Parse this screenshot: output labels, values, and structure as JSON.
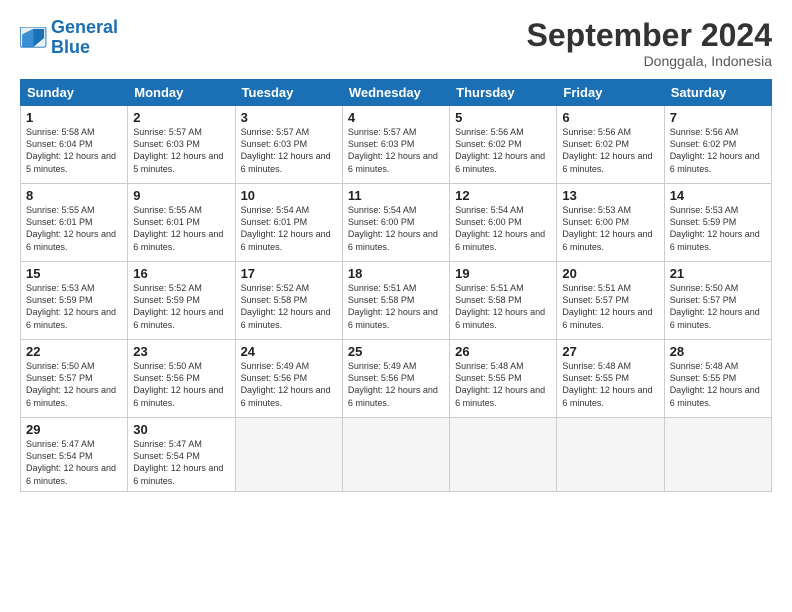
{
  "header": {
    "logo_line1": "General",
    "logo_line2": "Blue",
    "month": "September 2024",
    "location": "Donggala, Indonesia"
  },
  "days_of_week": [
    "Sunday",
    "Monday",
    "Tuesday",
    "Wednesday",
    "Thursday",
    "Friday",
    "Saturday"
  ],
  "weeks": [
    [
      {
        "day": "1",
        "sunrise": "5:58 AM",
        "sunset": "6:04 PM",
        "daylight": "12 hours and 5 minutes."
      },
      {
        "day": "2",
        "sunrise": "5:57 AM",
        "sunset": "6:03 PM",
        "daylight": "12 hours and 5 minutes."
      },
      {
        "day": "3",
        "sunrise": "5:57 AM",
        "sunset": "6:03 PM",
        "daylight": "12 hours and 6 minutes."
      },
      {
        "day": "4",
        "sunrise": "5:57 AM",
        "sunset": "6:03 PM",
        "daylight": "12 hours and 6 minutes."
      },
      {
        "day": "5",
        "sunrise": "5:56 AM",
        "sunset": "6:02 PM",
        "daylight": "12 hours and 6 minutes."
      },
      {
        "day": "6",
        "sunrise": "5:56 AM",
        "sunset": "6:02 PM",
        "daylight": "12 hours and 6 minutes."
      },
      {
        "day": "7",
        "sunrise": "5:56 AM",
        "sunset": "6:02 PM",
        "daylight": "12 hours and 6 minutes."
      }
    ],
    [
      {
        "day": "8",
        "sunrise": "5:55 AM",
        "sunset": "6:01 PM",
        "daylight": "12 hours and 6 minutes."
      },
      {
        "day": "9",
        "sunrise": "5:55 AM",
        "sunset": "6:01 PM",
        "daylight": "12 hours and 6 minutes."
      },
      {
        "day": "10",
        "sunrise": "5:54 AM",
        "sunset": "6:01 PM",
        "daylight": "12 hours and 6 minutes."
      },
      {
        "day": "11",
        "sunrise": "5:54 AM",
        "sunset": "6:00 PM",
        "daylight": "12 hours and 6 minutes."
      },
      {
        "day": "12",
        "sunrise": "5:54 AM",
        "sunset": "6:00 PM",
        "daylight": "12 hours and 6 minutes."
      },
      {
        "day": "13",
        "sunrise": "5:53 AM",
        "sunset": "6:00 PM",
        "daylight": "12 hours and 6 minutes."
      },
      {
        "day": "14",
        "sunrise": "5:53 AM",
        "sunset": "5:59 PM",
        "daylight": "12 hours and 6 minutes."
      }
    ],
    [
      {
        "day": "15",
        "sunrise": "5:53 AM",
        "sunset": "5:59 PM",
        "daylight": "12 hours and 6 minutes."
      },
      {
        "day": "16",
        "sunrise": "5:52 AM",
        "sunset": "5:59 PM",
        "daylight": "12 hours and 6 minutes."
      },
      {
        "day": "17",
        "sunrise": "5:52 AM",
        "sunset": "5:58 PM",
        "daylight": "12 hours and 6 minutes."
      },
      {
        "day": "18",
        "sunrise": "5:51 AM",
        "sunset": "5:58 PM",
        "daylight": "12 hours and 6 minutes."
      },
      {
        "day": "19",
        "sunrise": "5:51 AM",
        "sunset": "5:58 PM",
        "daylight": "12 hours and 6 minutes."
      },
      {
        "day": "20",
        "sunrise": "5:51 AM",
        "sunset": "5:57 PM",
        "daylight": "12 hours and 6 minutes."
      },
      {
        "day": "21",
        "sunrise": "5:50 AM",
        "sunset": "5:57 PM",
        "daylight": "12 hours and 6 minutes."
      }
    ],
    [
      {
        "day": "22",
        "sunrise": "5:50 AM",
        "sunset": "5:57 PM",
        "daylight": "12 hours and 6 minutes."
      },
      {
        "day": "23",
        "sunrise": "5:50 AM",
        "sunset": "5:56 PM",
        "daylight": "12 hours and 6 minutes."
      },
      {
        "day": "24",
        "sunrise": "5:49 AM",
        "sunset": "5:56 PM",
        "daylight": "12 hours and 6 minutes."
      },
      {
        "day": "25",
        "sunrise": "5:49 AM",
        "sunset": "5:56 PM",
        "daylight": "12 hours and 6 minutes."
      },
      {
        "day": "26",
        "sunrise": "5:48 AM",
        "sunset": "5:55 PM",
        "daylight": "12 hours and 6 minutes."
      },
      {
        "day": "27",
        "sunrise": "5:48 AM",
        "sunset": "5:55 PM",
        "daylight": "12 hours and 6 minutes."
      },
      {
        "day": "28",
        "sunrise": "5:48 AM",
        "sunset": "5:55 PM",
        "daylight": "12 hours and 6 minutes."
      }
    ],
    [
      {
        "day": "29",
        "sunrise": "5:47 AM",
        "sunset": "5:54 PM",
        "daylight": "12 hours and 6 minutes."
      },
      {
        "day": "30",
        "sunrise": "5:47 AM",
        "sunset": "5:54 PM",
        "daylight": "12 hours and 6 minutes."
      },
      null,
      null,
      null,
      null,
      null
    ]
  ]
}
